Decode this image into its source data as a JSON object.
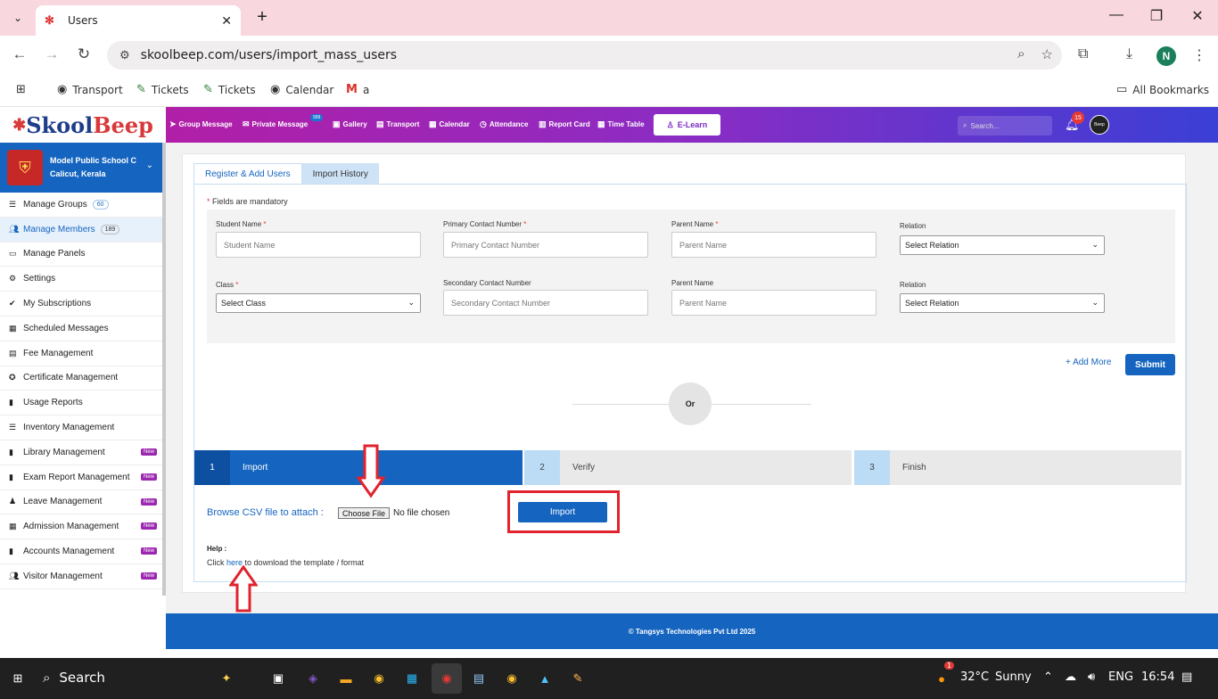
{
  "browser": {
    "tab_title": "Users",
    "tab_close": "✕",
    "new_tab": "+",
    "url": "skoolbeep.com/users/import_mass_users",
    "bookmarks": [
      "Transport",
      "Tickets",
      "Tickets",
      "Calendar",
      "a"
    ],
    "all_bookmarks": "All Bookmarks",
    "profile_initial": "N"
  },
  "app": {
    "logo_part1": "Skool",
    "logo_part2": "Beep",
    "nav": [
      {
        "label": "Group Message",
        "icon": "paper-plane-icon"
      },
      {
        "label": "Private Message",
        "icon": "envelope-icon"
      },
      {
        "label": "Gallery",
        "icon": "image-icon"
      },
      {
        "label": "Transport",
        "icon": "bus-icon"
      },
      {
        "label": "Calendar",
        "icon": "calendar-icon"
      },
      {
        "label": "Attendance",
        "icon": "clock-icon"
      },
      {
        "label": "Report Card",
        "icon": "report-icon"
      },
      {
        "label": "Time Table",
        "icon": "timetable-icon"
      }
    ],
    "private_message_badge": "999",
    "elearn": "E-Learn",
    "search_placeholder": "Search...",
    "notification_count": "15",
    "profile_text": "Beep"
  },
  "sidebar": {
    "school_name": "Model Public School C",
    "school_location": "Calicut, Kerala",
    "items": [
      {
        "label": "Manage Groups",
        "count": "60"
      },
      {
        "label": "Manage Members",
        "count": "189",
        "active": true
      },
      {
        "label": "Manage Panels"
      },
      {
        "label": "Settings"
      },
      {
        "label": "My Subscriptions"
      },
      {
        "label": "Scheduled Messages"
      },
      {
        "label": "Fee Management"
      },
      {
        "label": "Certificate Management"
      },
      {
        "label": "Usage Reports"
      },
      {
        "label": "Inventory Management"
      },
      {
        "label": "Library Management",
        "new": "New"
      },
      {
        "label": "Exam Report Management",
        "new": "New"
      },
      {
        "label": "Leave Management",
        "new": "New"
      },
      {
        "label": "Admission Management",
        "new": "New"
      },
      {
        "label": "Accounts Management",
        "new": "New"
      },
      {
        "label": "Visitor Management",
        "new": "New"
      }
    ]
  },
  "main": {
    "tabs": [
      "Register & Add Users",
      "Import History"
    ],
    "mandatory_note": "Fields are mandatory",
    "form": {
      "student_name_label": "Student Name",
      "student_name_placeholder": "Student Name",
      "primary_contact_label": "Primary Contact Number",
      "primary_contact_placeholder": "Primary Contact Number",
      "parent_name_label_1": "Parent Name",
      "parent_name_placeholder_1": "Parent Name",
      "relation_label_1": "Relation",
      "relation_value_1": "Select Relation",
      "class_label": "Class",
      "class_value": "Select Class",
      "secondary_contact_label": "Secondary Contact Number",
      "secondary_contact_placeholder": "Secondary Contact Number",
      "parent_name_label_2": "Parent Name",
      "parent_name_placeholder_2": "Parent Name",
      "relation_label_2": "Relation",
      "relation_value_2": "Select Relation"
    },
    "add_more": "Add More",
    "submit": "Submit",
    "or": "Or",
    "steps": [
      {
        "num": "1",
        "label": "Import"
      },
      {
        "num": "2",
        "label": "Verify"
      },
      {
        "num": "3",
        "label": "Finish"
      }
    ],
    "browse_label": "Browse CSV file to attach :",
    "choose_file": "Choose File",
    "no_file": "No file chosen",
    "import_button": "Import",
    "help_title": "Help :",
    "help_prefix": "Click",
    "help_link": "here",
    "help_suffix": "to download the template / format"
  },
  "footer": "© Tangsys Technologies Pvt Ltd 2025",
  "taskbar": {
    "search": "Search",
    "weather_badge": "1",
    "temperature": "32°C",
    "condition": "Sunny",
    "language": "ENG",
    "time": "16:54"
  }
}
